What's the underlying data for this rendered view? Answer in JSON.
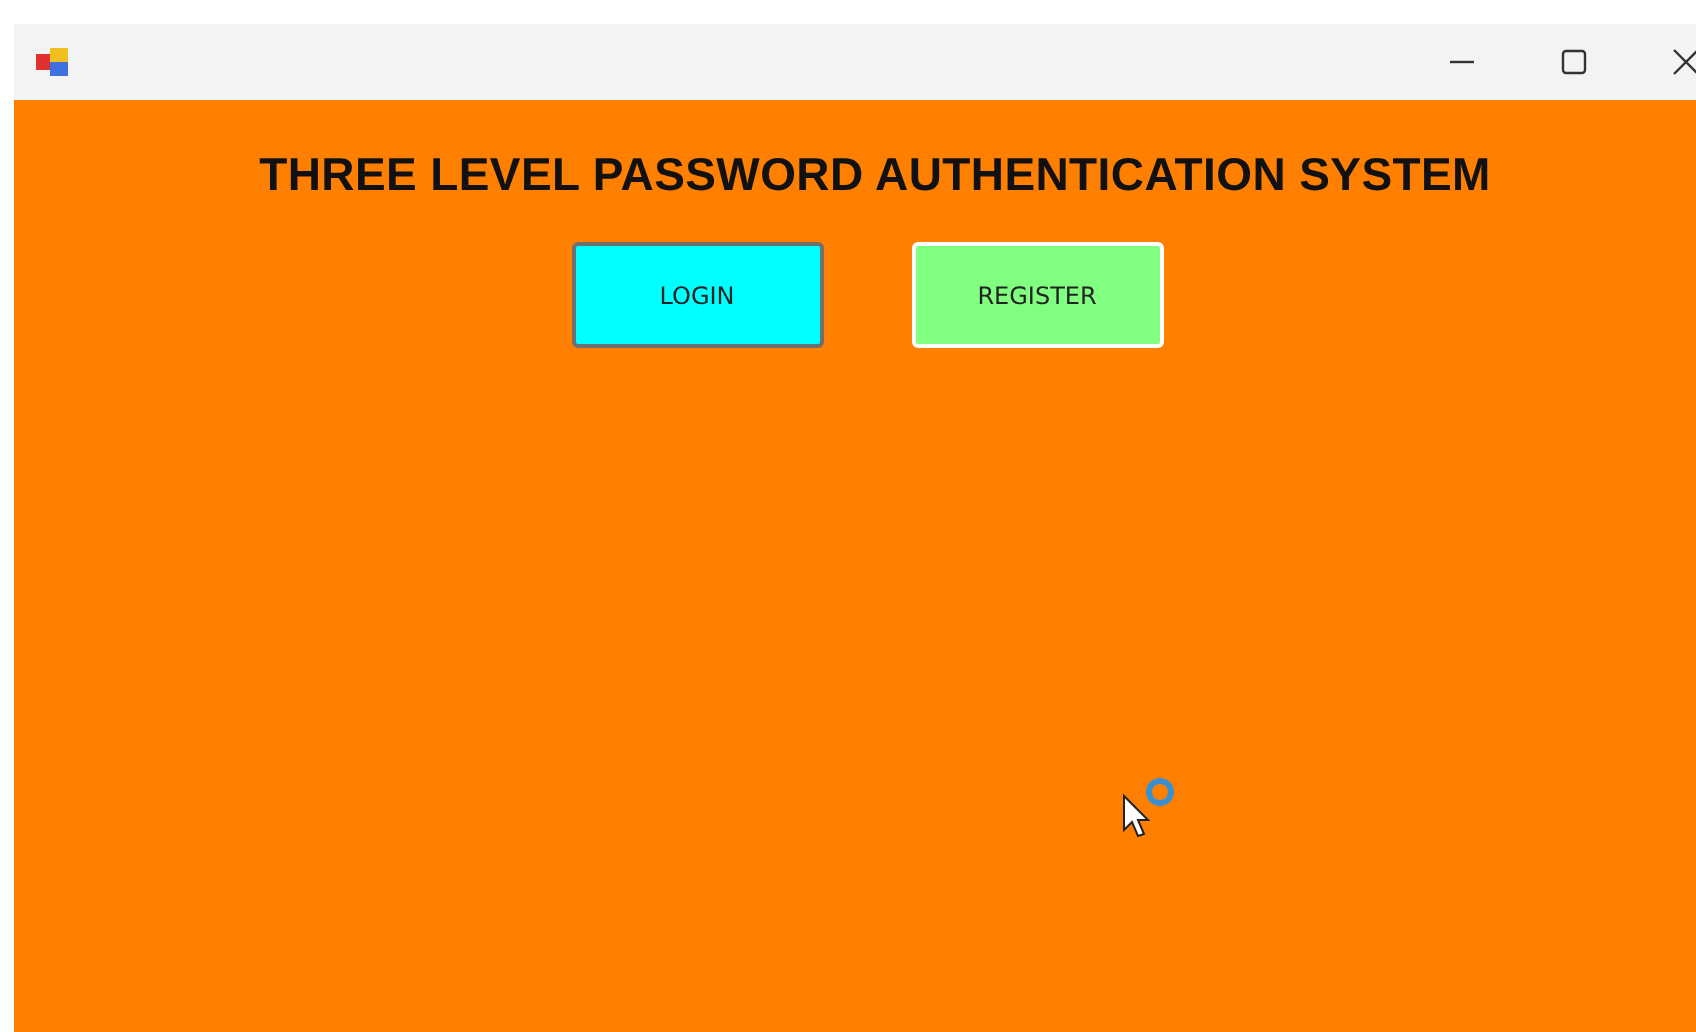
{
  "heading": "THREE LEVEL PASSWORD AUTHENTICATION SYSTEM",
  "buttons": [
    {
      "label": "LOGIN",
      "color": "#00ffff",
      "focused": true
    },
    {
      "label": "REGISTER",
      "color": "#80ff80",
      "focused": false
    }
  ]
}
